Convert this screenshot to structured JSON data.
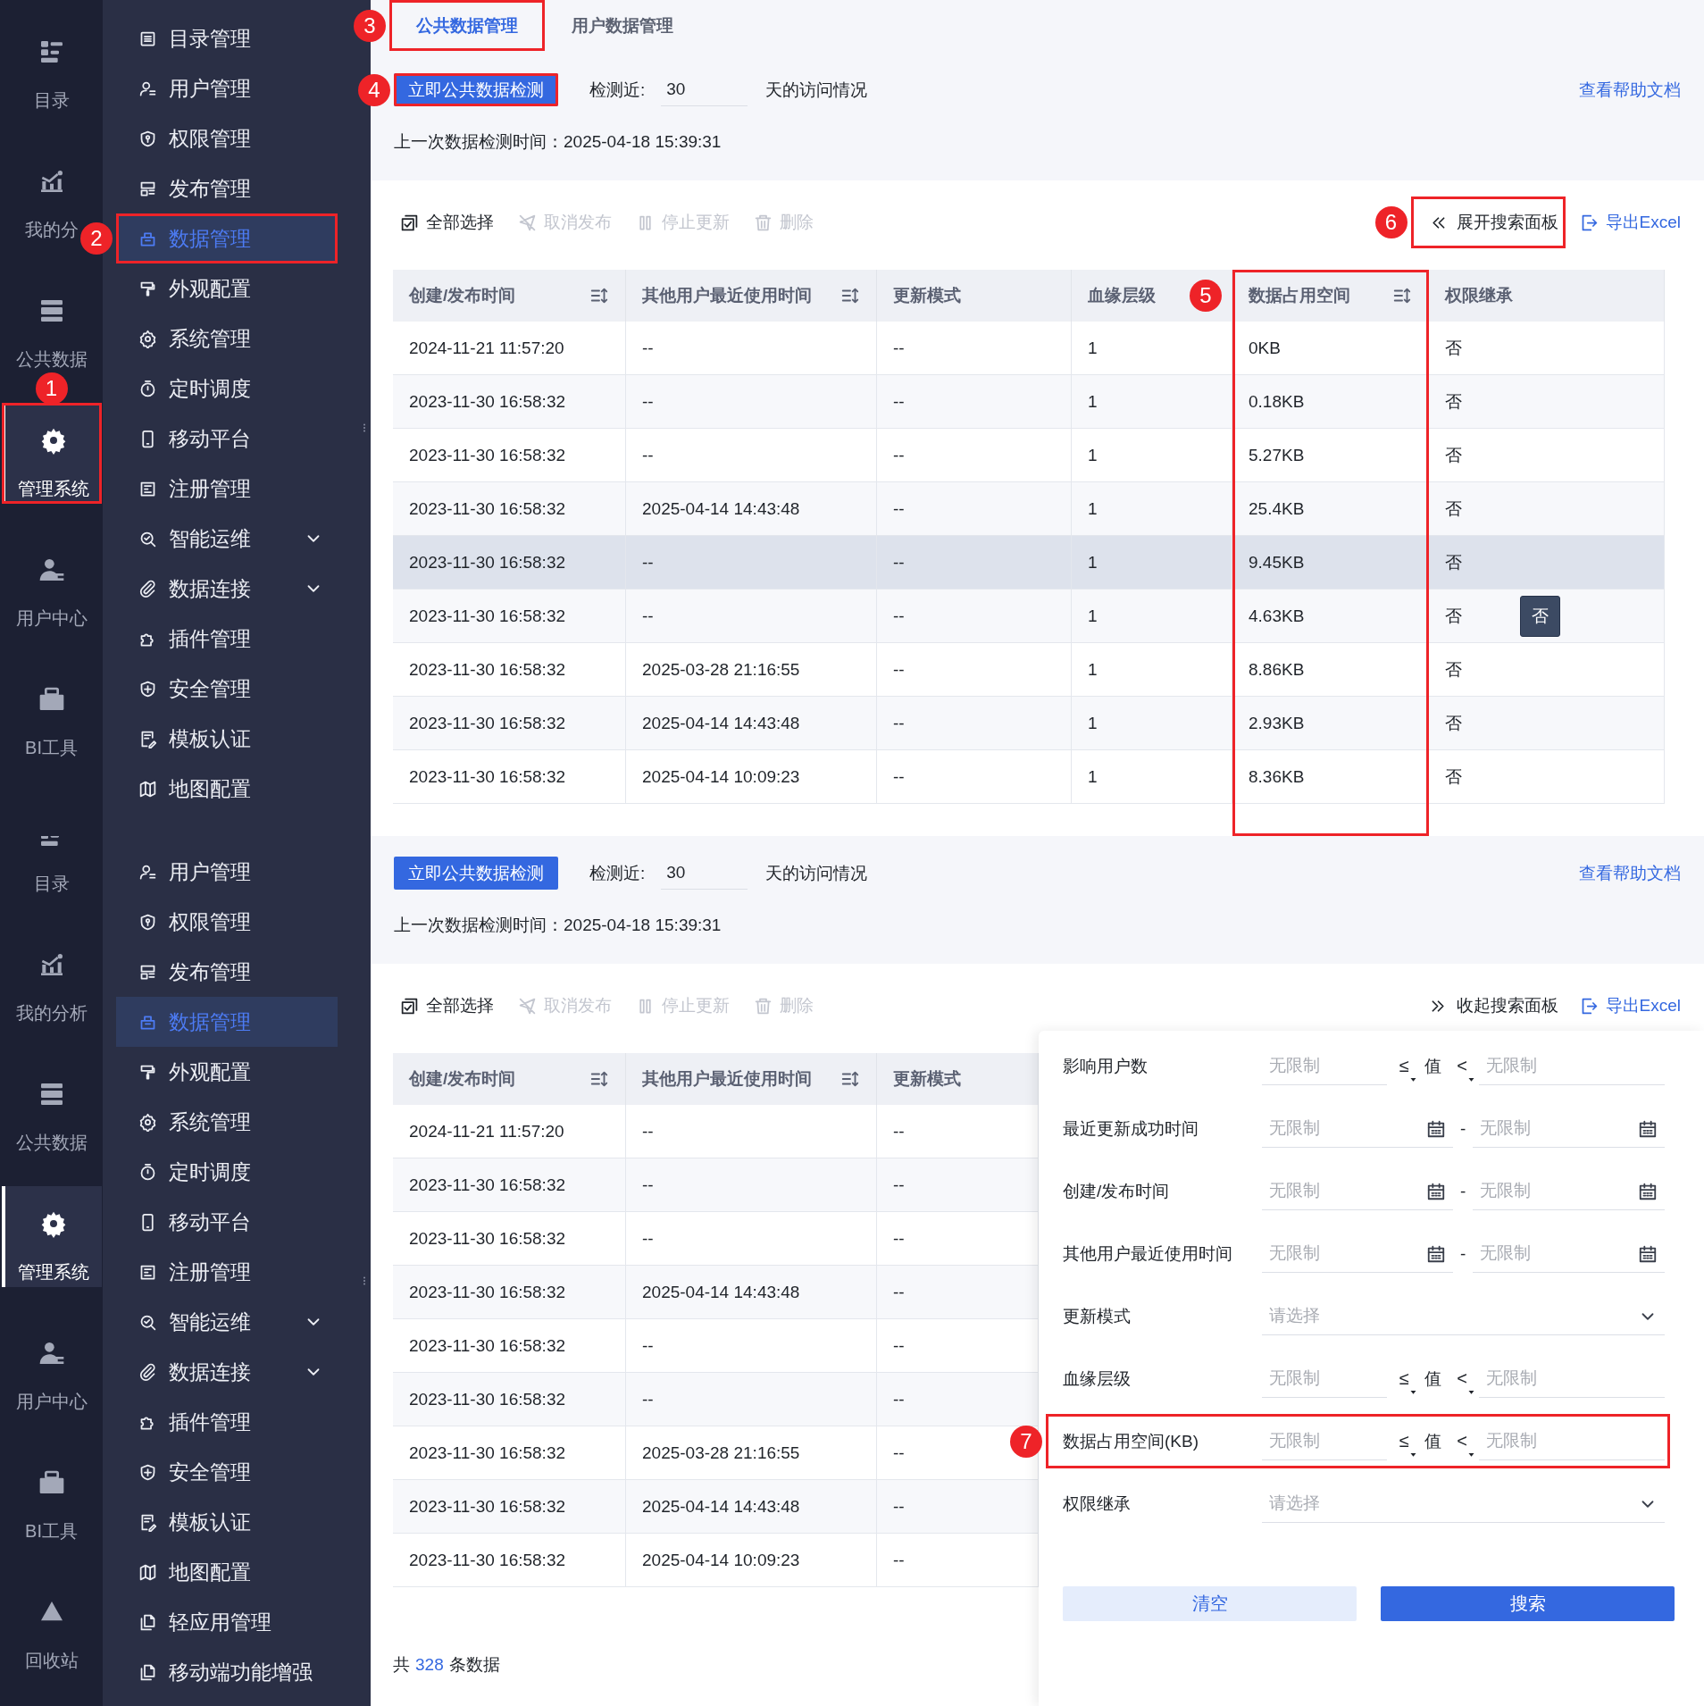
{
  "screens": [
    {
      "rail": {
        "items": [
          {
            "label": "目录",
            "selected": false,
            "highlighted": false
          },
          {
            "label": "我的分",
            "selected": false,
            "highlighted": false
          },
          {
            "label": "公共数据",
            "selected": false,
            "highlighted": false
          },
          {
            "label": "管理系统",
            "selected": true,
            "highlighted": true,
            "callout": "1"
          },
          {
            "label": "用户中心",
            "selected": false,
            "highlighted": false
          },
          {
            "label": "BI工具",
            "selected": false,
            "highlighted": false
          }
        ]
      },
      "sidebar": {
        "items": [
          {
            "label": "目录管理",
            "kind": "page",
            "selected": false,
            "highlighted": false
          },
          {
            "label": "用户管理",
            "kind": "page",
            "selected": false,
            "highlighted": false
          },
          {
            "label": "权限管理",
            "kind": "page",
            "selected": false,
            "highlighted": false
          },
          {
            "label": "发布管理",
            "kind": "page",
            "selected": false,
            "highlighted": false
          },
          {
            "label": "数据管理",
            "kind": "page",
            "selected": true,
            "highlighted": true,
            "callout": "2"
          },
          {
            "label": "外观配置",
            "kind": "page",
            "selected": false,
            "highlighted": false
          },
          {
            "label": "系统管理",
            "kind": "page",
            "selected": false,
            "highlighted": false
          },
          {
            "label": "定时调度",
            "kind": "page",
            "selected": false,
            "highlighted": false
          },
          {
            "label": "移动平台",
            "kind": "page",
            "selected": false,
            "highlighted": false
          },
          {
            "label": "注册管理",
            "kind": "page",
            "selected": false,
            "highlighted": false
          },
          {
            "label": "智能运维",
            "kind": "submenu",
            "selected": false,
            "highlighted": false
          },
          {
            "label": "数据连接",
            "kind": "submenu",
            "selected": false,
            "highlighted": false
          },
          {
            "label": "插件管理",
            "kind": "page",
            "selected": false,
            "highlighted": false
          },
          {
            "label": "安全管理",
            "kind": "page",
            "selected": false,
            "highlighted": false
          },
          {
            "label": "模板认证",
            "kind": "page",
            "selected": false,
            "highlighted": false
          },
          {
            "label": "地图配置",
            "kind": "page",
            "selected": false,
            "highlighted": false
          }
        ]
      },
      "tabs": [
        {
          "label": "公共数据管理",
          "selected": true,
          "highlighted": true,
          "callout": "3"
        },
        {
          "label": "用户数据管理",
          "selected": false,
          "highlighted": false
        }
      ],
      "check": {
        "button": {
          "label": "立即公共数据检测",
          "highlighted": true,
          "callout": "4"
        },
        "days_label": "检测近:",
        "days_value": "30",
        "days_suffix": "天的访问情况",
        "help_link": "查看帮助文档",
        "last_check": "上一次数据检测时间：2025-04-18 15:39:31"
      },
      "toolbar": {
        "actions": [
          {
            "label": "全部选择",
            "disabled": false
          },
          {
            "label": "取消发布",
            "disabled": true
          },
          {
            "label": "停止更新",
            "disabled": true
          },
          {
            "label": "删除",
            "disabled": true
          }
        ],
        "panel_toggle": {
          "label": "展开搜索面板",
          "expanded": false,
          "highlighted": true,
          "callout": "6"
        },
        "export": "导出Excel"
      },
      "table": {
        "columns": [
          {
            "label": "创建/发布时间",
            "sortable": true,
            "highlighted": false
          },
          {
            "label": "其他用户最近使用时间",
            "sortable": true,
            "highlighted": false
          },
          {
            "label": "更新模式",
            "sortable": false,
            "highlighted": false
          },
          {
            "label": "血缘层级",
            "sortable": false,
            "highlighted": false
          },
          {
            "label": "数据占用空间",
            "sortable": true,
            "highlighted": true,
            "callout": "5"
          },
          {
            "label": "权限继承",
            "sortable": false,
            "highlighted": false
          }
        ],
        "rows": [
          {
            "cells": [
              "2024-11-21 11:57:20",
              "--",
              "--",
              "1",
              "0KB",
              "否"
            ],
            "hovered": false
          },
          {
            "cells": [
              "2023-11-30 16:58:32",
              "--",
              "--",
              "1",
              "0.18KB",
              "否"
            ],
            "hovered": false
          },
          {
            "cells": [
              "2023-11-30 16:58:32",
              "--",
              "--",
              "1",
              "5.27KB",
              "否"
            ],
            "hovered": false
          },
          {
            "cells": [
              "2023-11-30 16:58:32",
              "2025-04-14 14:43:48",
              "--",
              "1",
              "25.4KB",
              "否"
            ],
            "hovered": false
          },
          {
            "cells": [
              "2023-11-30 16:58:32",
              "--",
              "--",
              "1",
              "9.45KB",
              "否"
            ],
            "hovered": true
          },
          {
            "cells": [
              "2023-11-30 16:58:32",
              "--",
              "--",
              "1",
              "4.63KB",
              "否"
            ],
            "hovered": false,
            "tooltip": "否"
          },
          {
            "cells": [
              "2023-11-30 16:58:32",
              "2025-03-28 21:16:55",
              "--",
              "1",
              "8.86KB",
              "否"
            ],
            "hovered": false
          },
          {
            "cells": [
              "2023-11-30 16:58:32",
              "2025-04-14 14:43:48",
              "--",
              "1",
              "2.93KB",
              "否"
            ],
            "hovered": false
          },
          {
            "cells": [
              "2023-11-30 16:58:32",
              "2025-04-14 10:09:23",
              "--",
              "1",
              "8.36KB",
              "否"
            ],
            "hovered": false
          }
        ]
      }
    },
    {
      "rail": {
        "items": [
          {
            "label": "目录",
            "selected": false,
            "highlighted": false
          },
          {
            "label": "我的分析",
            "selected": false,
            "highlighted": false
          },
          {
            "label": "公共数据",
            "selected": false,
            "highlighted": false
          },
          {
            "label": "管理系统",
            "selected": true,
            "highlighted": false
          },
          {
            "label": "用户中心",
            "selected": false,
            "highlighted": false
          },
          {
            "label": "BI工具",
            "selected": false,
            "highlighted": false
          },
          {
            "label": "回收站",
            "selected": false,
            "highlighted": false
          }
        ]
      },
      "sidebar": {
        "items": [
          {
            "label": "用户管理",
            "kind": "page",
            "selected": false,
            "highlighted": false
          },
          {
            "label": "权限管理",
            "kind": "page",
            "selected": false,
            "highlighted": false
          },
          {
            "label": "发布管理",
            "kind": "page",
            "selected": false,
            "highlighted": false
          },
          {
            "label": "数据管理",
            "kind": "page",
            "selected": true,
            "highlighted": false
          },
          {
            "label": "外观配置",
            "kind": "page",
            "selected": false,
            "highlighted": false
          },
          {
            "label": "系统管理",
            "kind": "page",
            "selected": false,
            "highlighted": false
          },
          {
            "label": "定时调度",
            "kind": "page",
            "selected": false,
            "highlighted": false
          },
          {
            "label": "移动平台",
            "kind": "page",
            "selected": false,
            "highlighted": false
          },
          {
            "label": "注册管理",
            "kind": "page",
            "selected": false,
            "highlighted": false
          },
          {
            "label": "智能运维",
            "kind": "submenu",
            "selected": false,
            "highlighted": false
          },
          {
            "label": "数据连接",
            "kind": "submenu",
            "selected": false,
            "highlighted": false
          },
          {
            "label": "插件管理",
            "kind": "page",
            "selected": false,
            "highlighted": false
          },
          {
            "label": "安全管理",
            "kind": "page",
            "selected": false,
            "highlighted": false
          },
          {
            "label": "模板认证",
            "kind": "page",
            "selected": false,
            "highlighted": false
          },
          {
            "label": "地图配置",
            "kind": "page",
            "selected": false,
            "highlighted": false
          },
          {
            "label": "轻应用管理",
            "kind": "page",
            "selected": false,
            "highlighted": false
          },
          {
            "label": "移动端功能增强",
            "kind": "page",
            "selected": false,
            "highlighted": false
          }
        ]
      },
      "check": {
        "button": {
          "label": "立即公共数据检测",
          "highlighted": false
        },
        "days_label": "检测近:",
        "days_value": "30",
        "days_suffix": "天的访问情况",
        "help_link": "查看帮助文档",
        "last_check": "上一次数据检测时间：2025-04-18 15:39:31"
      },
      "toolbar": {
        "actions": [
          {
            "label": "全部选择",
            "disabled": false
          },
          {
            "label": "取消发布",
            "disabled": true
          },
          {
            "label": "停止更新",
            "disabled": true
          },
          {
            "label": "删除",
            "disabled": true
          }
        ],
        "panel_toggle": {
          "label": "收起搜索面板",
          "expanded": true,
          "highlighted": false
        },
        "export": "导出Excel"
      },
      "table": {
        "columns": [
          {
            "label": "创建/发布时间",
            "sortable": true,
            "highlighted": false
          },
          {
            "label": "其他用户最近使用时间",
            "sortable": true,
            "highlighted": false
          },
          {
            "label": "更新模式",
            "sortable": false,
            "highlighted": false
          }
        ],
        "rows": [
          {
            "cells": [
              "2024-11-21 11:57:20",
              "--",
              "--"
            ],
            "hovered": false
          },
          {
            "cells": [
              "2023-11-30 16:58:32",
              "--",
              "--"
            ],
            "hovered": false
          },
          {
            "cells": [
              "2023-11-30 16:58:32",
              "--",
              "--"
            ],
            "hovered": false
          },
          {
            "cells": [
              "2023-11-30 16:58:32",
              "2025-04-14 14:43:48",
              "--"
            ],
            "hovered": false
          },
          {
            "cells": [
              "2023-11-30 16:58:32",
              "--",
              "--"
            ],
            "hovered": false
          },
          {
            "cells": [
              "2023-11-30 16:58:32",
              "--",
              "--"
            ],
            "hovered": false
          },
          {
            "cells": [
              "2023-11-30 16:58:32",
              "2025-03-28 21:16:55",
              "--"
            ],
            "hovered": false
          },
          {
            "cells": [
              "2023-11-30 16:58:32",
              "2025-04-14 14:43:48",
              "--"
            ],
            "hovered": false
          },
          {
            "cells": [
              "2023-11-30 16:58:32",
              "2025-04-14 10:09:23",
              "--"
            ],
            "hovered": false
          }
        ]
      },
      "footer": {
        "prefix": "共",
        "count": "328",
        "suffix": "条数据"
      },
      "search_panel": {
        "fields": [
          {
            "label": "影响用户数",
            "kind": "range",
            "placeholders": [
              "无限制",
              "无限制"
            ],
            "min_operator": "≤",
            "value_label": "值",
            "max_operator": "<",
            "highlighted": false
          },
          {
            "label": "最近更新成功时间",
            "kind": "date_range",
            "placeholders": [
              "无限制",
              "无限制"
            ],
            "separator": "-",
            "highlighted": false
          },
          {
            "label": "创建/发布时间",
            "kind": "date_range",
            "placeholders": [
              "无限制",
              "无限制"
            ],
            "separator": "-",
            "highlighted": false
          },
          {
            "label": "其他用户最近使用时间",
            "kind": "date_range",
            "placeholders": [
              "无限制",
              "无限制"
            ],
            "separator": "-",
            "highlighted": false
          },
          {
            "label": "更新模式",
            "kind": "select",
            "placeholders": [
              "请选择"
            ],
            "highlighted": false
          },
          {
            "label": "血缘层级",
            "kind": "range",
            "placeholders": [
              "无限制",
              "无限制"
            ],
            "min_operator": "≤",
            "value_label": "值",
            "max_operator": "<",
            "highlighted": false
          },
          {
            "label": "数据占用空间(KB)",
            "kind": "range",
            "placeholders": [
              "无限制",
              "无限制"
            ],
            "min_operator": "≤",
            "value_label": "值",
            "max_operator": "<",
            "highlighted": true,
            "callout": "7"
          },
          {
            "label": "权限继承",
            "kind": "select",
            "placeholders": [
              "请选择"
            ],
            "highlighted": false
          }
        ],
        "buttons": [
          {
            "label": "清空",
            "kind": "secondary"
          },
          {
            "label": "搜索",
            "kind": "primary"
          }
        ]
      }
    }
  ]
}
